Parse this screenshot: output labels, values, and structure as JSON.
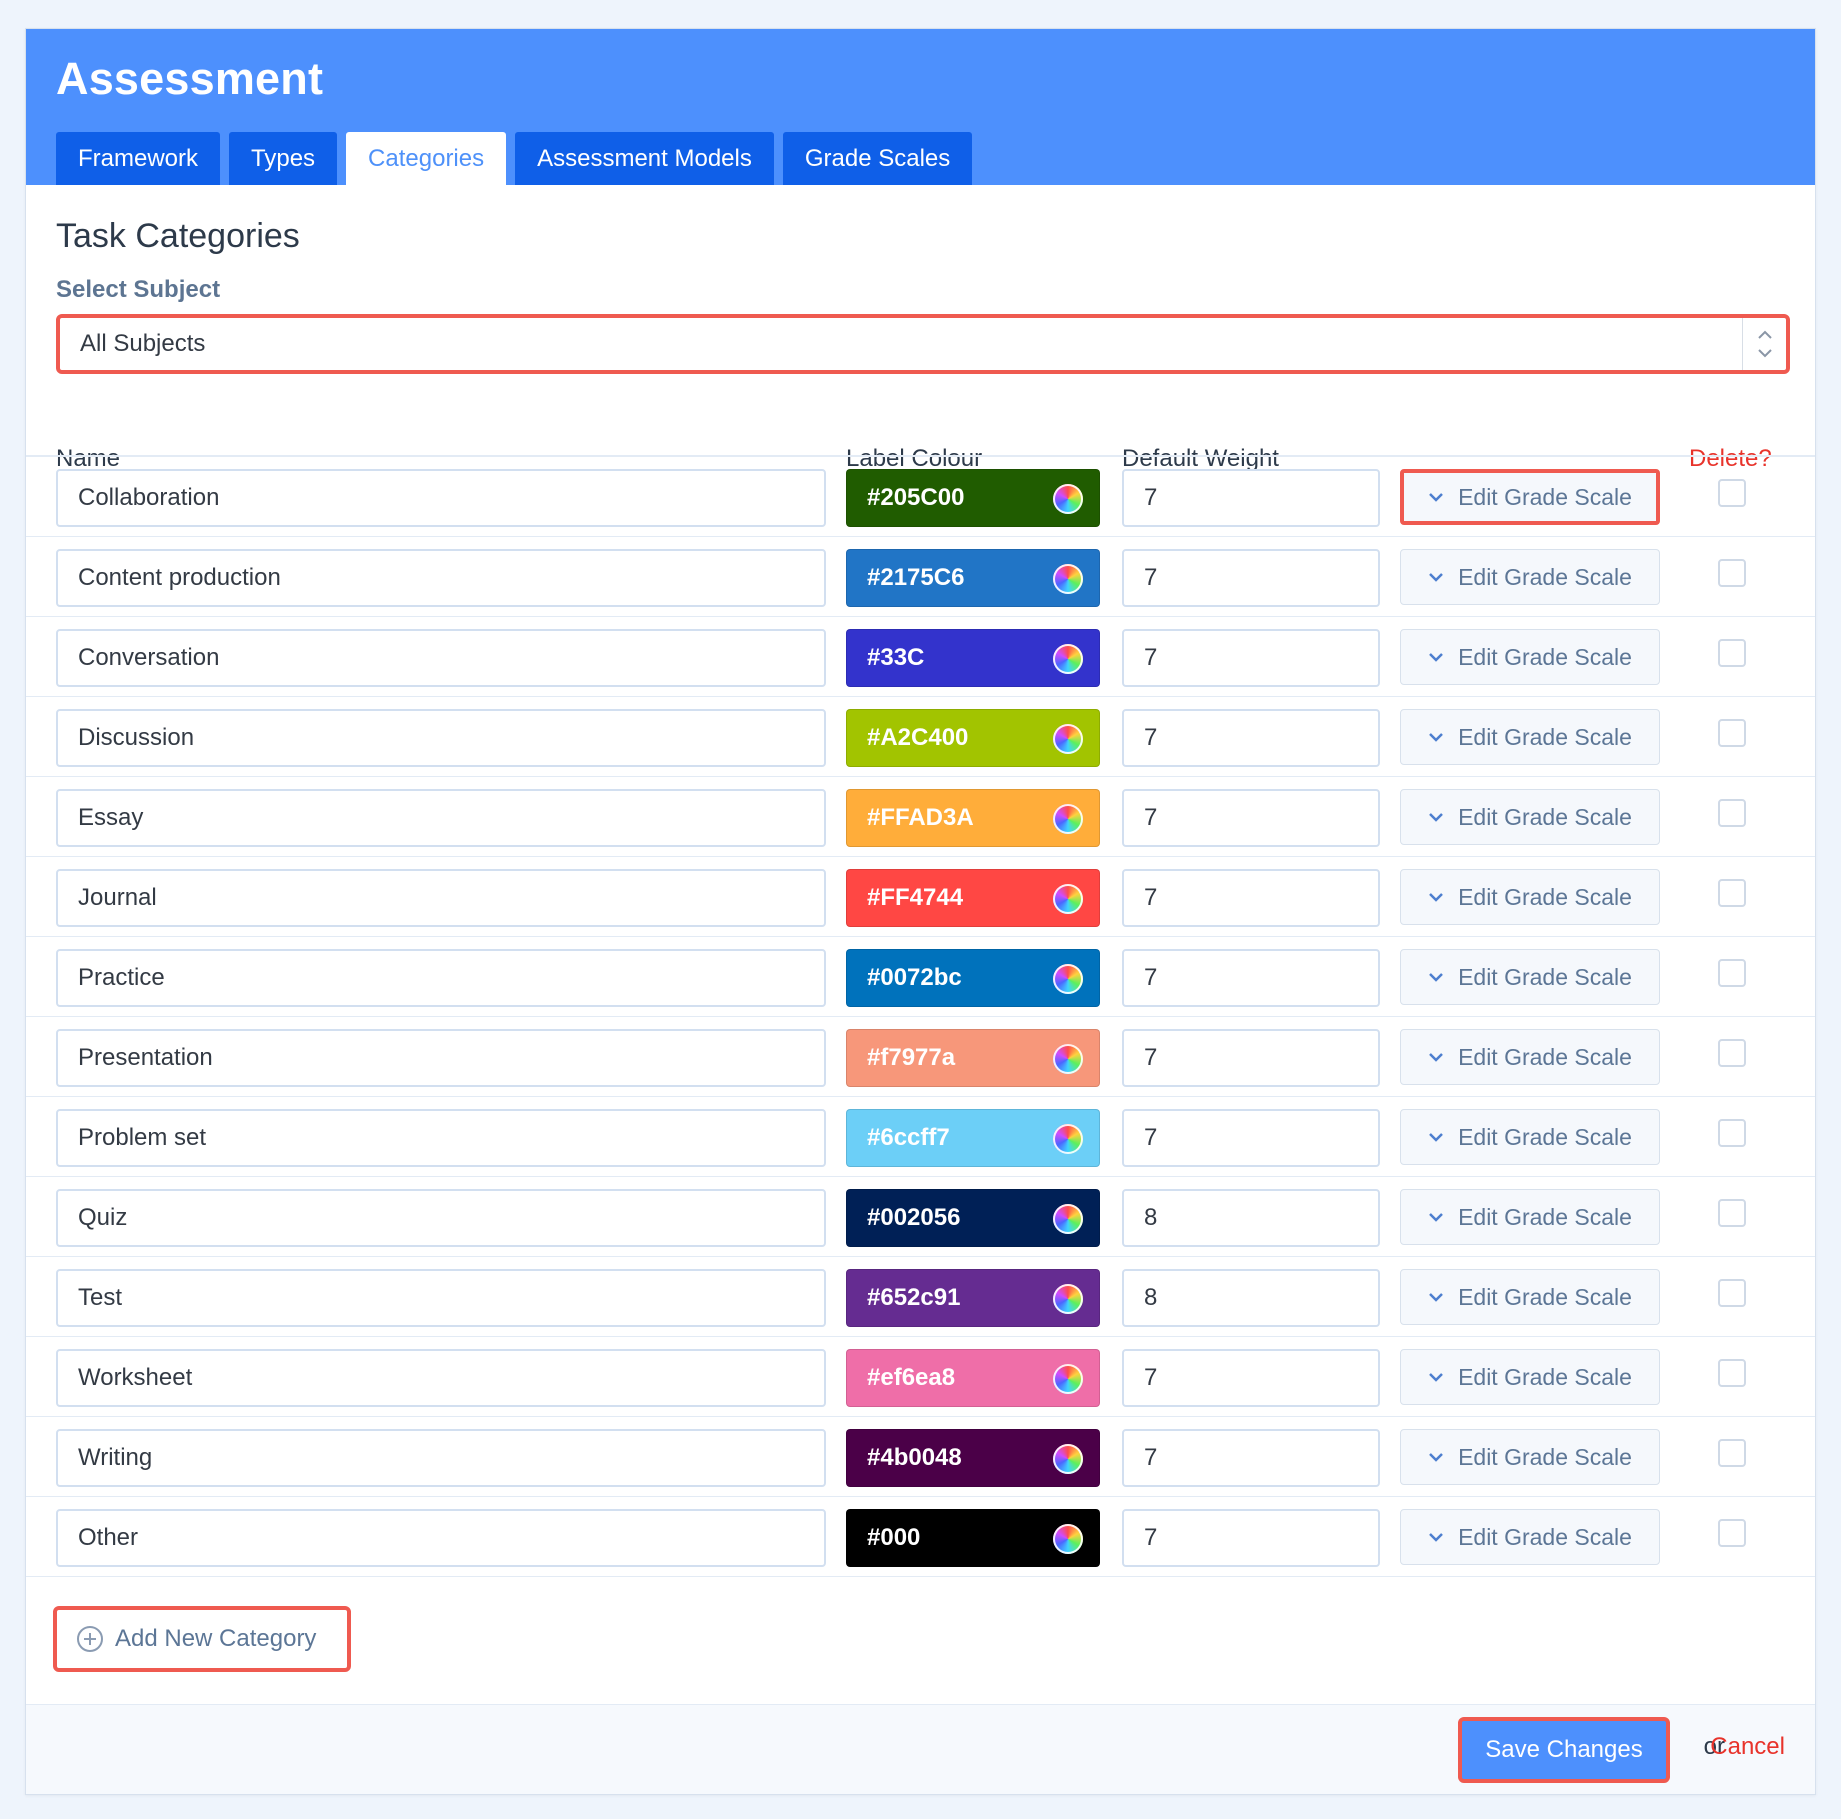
{
  "header": {
    "title": "Assessment",
    "tabs": [
      {
        "label": "Framework",
        "active": false
      },
      {
        "label": "Types",
        "active": false
      },
      {
        "label": "Categories",
        "active": true
      },
      {
        "label": "Assessment Models",
        "active": false
      },
      {
        "label": "Grade Scales",
        "active": false
      }
    ]
  },
  "section_title": "Task Categories",
  "subject_select": {
    "label": "Select Subject",
    "value": "All Subjects"
  },
  "columns": {
    "name": "Name",
    "label_colour": "Label Colour",
    "default_weight": "Default Weight",
    "delete": "Delete?"
  },
  "edit_grade_scale_label": "Edit Grade Scale",
  "categories": [
    {
      "name": "Collaboration",
      "colour": "#205C00",
      "weight": "7",
      "text_dark": false
    },
    {
      "name": "Content production",
      "colour": "#2175C6",
      "weight": "7",
      "text_dark": false
    },
    {
      "name": "Conversation",
      "colour": "#33C",
      "weight": "7",
      "text_dark": false
    },
    {
      "name": "Discussion",
      "colour": "#A2C400",
      "weight": "7",
      "text_dark": false
    },
    {
      "name": "Essay",
      "colour": "#FFAD3A",
      "weight": "7",
      "text_dark": false
    },
    {
      "name": "Journal",
      "colour": "#FF4744",
      "weight": "7",
      "text_dark": false
    },
    {
      "name": "Practice",
      "colour": "#0072bc",
      "weight": "7",
      "text_dark": false
    },
    {
      "name": "Presentation",
      "colour": "#f7977a",
      "weight": "7",
      "text_dark": false
    },
    {
      "name": "Problem set",
      "colour": "#6ccff7",
      "weight": "7",
      "text_dark": false
    },
    {
      "name": "Quiz",
      "colour": "#002056",
      "weight": "8",
      "text_dark": false
    },
    {
      "name": "Test",
      "colour": "#652c91",
      "weight": "8",
      "text_dark": false
    },
    {
      "name": "Worksheet",
      "colour": "#ef6ea8",
      "weight": "7",
      "text_dark": false
    },
    {
      "name": "Writing",
      "colour": "#4b0048",
      "weight": "7",
      "text_dark": false
    },
    {
      "name": "Other",
      "colour": "#000",
      "weight": "7",
      "text_dark": false
    }
  ],
  "add_button": "Add New Category",
  "footer": {
    "save": "Save Changes",
    "or": "or",
    "cancel": "Cancel"
  }
}
